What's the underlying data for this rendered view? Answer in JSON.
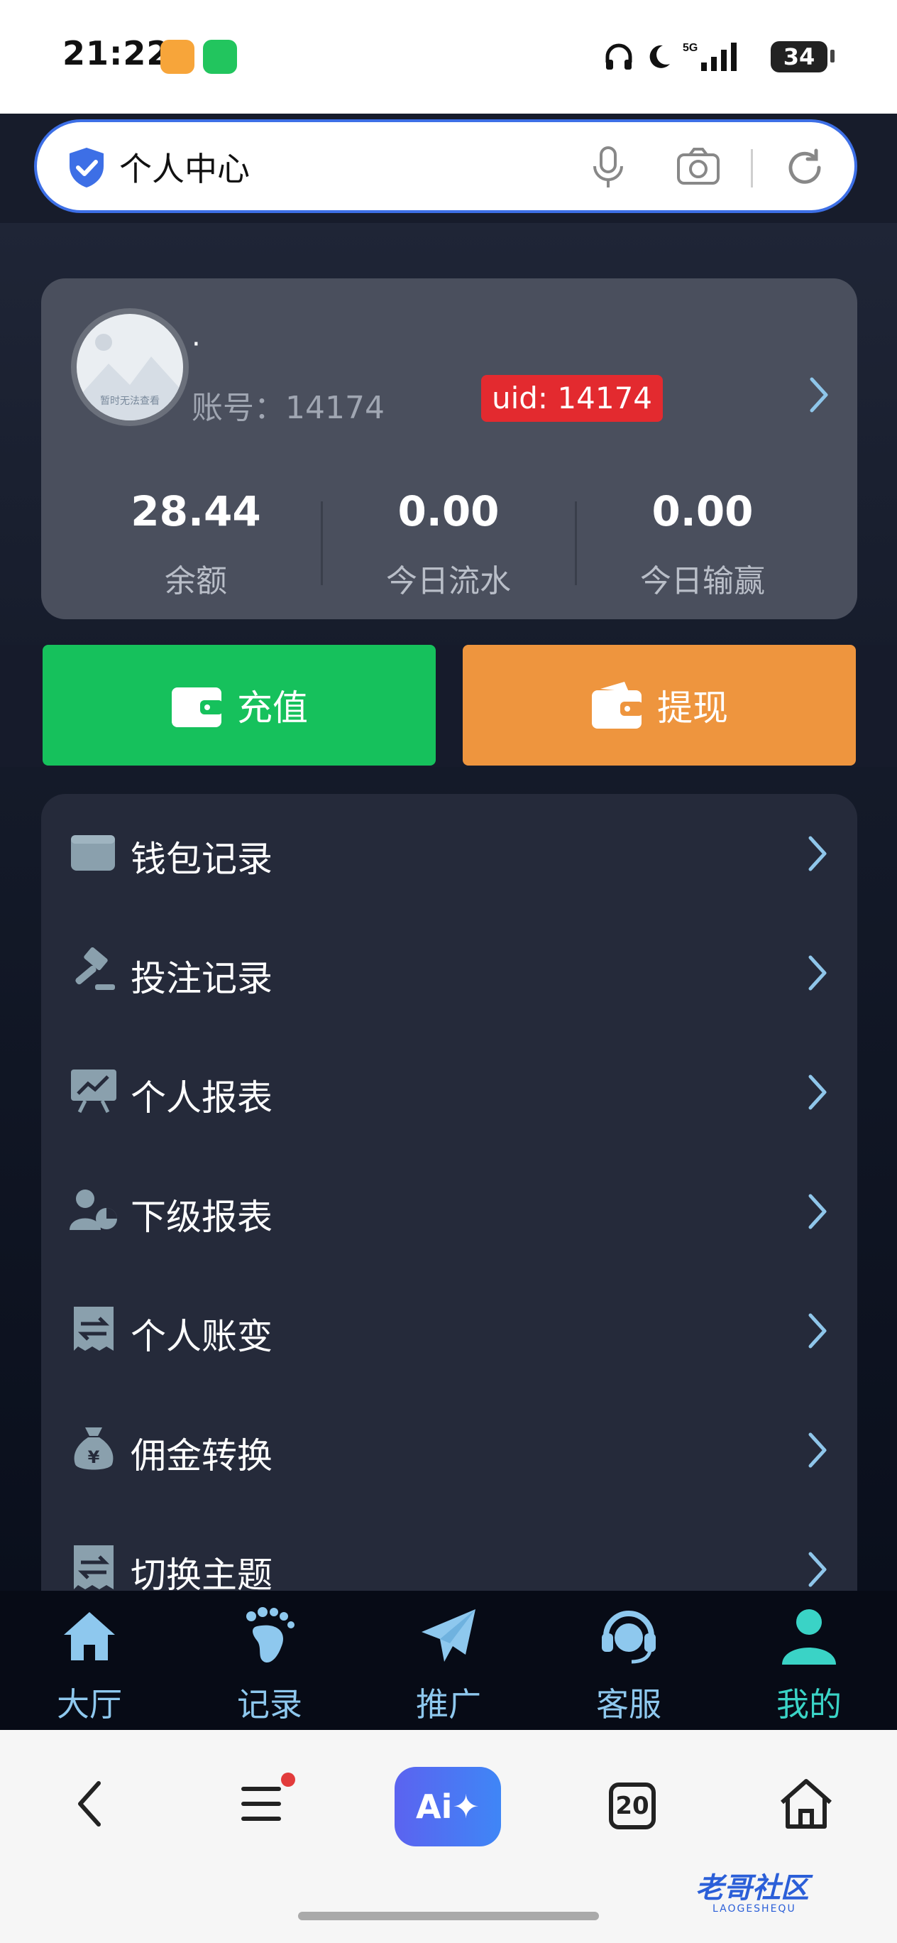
{
  "status_bar": {
    "time": "21:22",
    "battery": "34"
  },
  "browser": {
    "address_text": "个人中心"
  },
  "user": {
    "name": "·",
    "avatar_text": "暂时无法查看",
    "account_label": "账号：14174",
    "uid_badge": "uid: 14174"
  },
  "stats": [
    {
      "value": "28.44",
      "label": "余额"
    },
    {
      "value": "0.00",
      "label": "今日流水"
    },
    {
      "value": "0.00",
      "label": "今日输赢"
    }
  ],
  "actions": {
    "recharge": "充值",
    "withdraw": "提现"
  },
  "menu": [
    {
      "label": "钱包记录",
      "icon": "wallet-icon"
    },
    {
      "label": "投注记录",
      "icon": "gavel-icon"
    },
    {
      "label": "个人报表",
      "icon": "chart-board-icon"
    },
    {
      "label": "下级报表",
      "icon": "user-pie-icon"
    },
    {
      "label": "个人账变",
      "icon": "receipt-exchange-icon"
    },
    {
      "label": "佣金转换",
      "icon": "money-bag-icon"
    },
    {
      "label": "切换主题",
      "icon": "switch-theme-icon"
    }
  ],
  "tabs": [
    {
      "label": "大厅",
      "icon": "home-icon"
    },
    {
      "label": "记录",
      "icon": "footprint-icon"
    },
    {
      "label": "推广",
      "icon": "paper-plane-icon"
    },
    {
      "label": "客服",
      "icon": "headset-icon"
    },
    {
      "label": "我的",
      "icon": "user-icon",
      "active": true
    }
  ],
  "browser_nav": {
    "ai_label": "Ai✦",
    "tab_count": "20"
  },
  "watermark": {
    "text": "老哥社区",
    "sub": "LAOGESHEQU"
  },
  "colors": {
    "accent_green": "#16c15c",
    "accent_orange": "#ee953e",
    "uid_red": "#e32a2f",
    "tab_active": "#3ad3c6",
    "tab_inactive": "#8ec8ee"
  }
}
